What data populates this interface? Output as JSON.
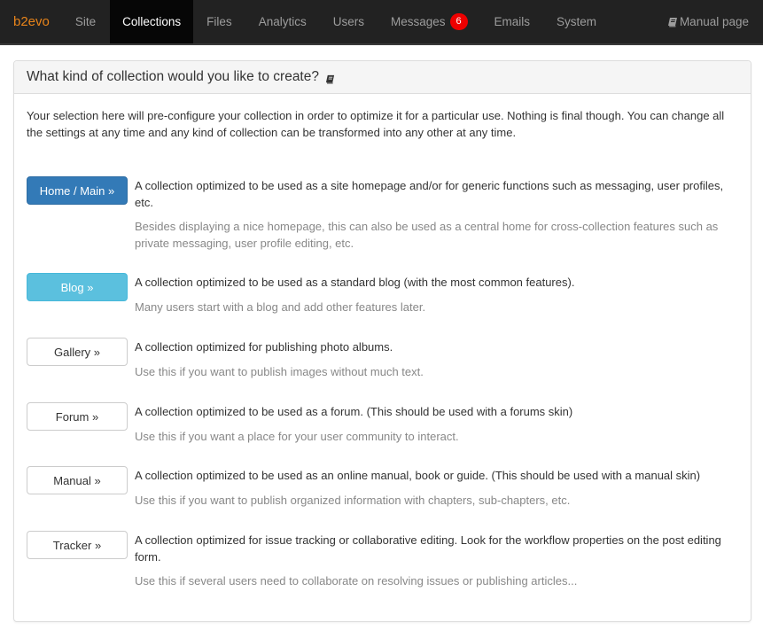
{
  "navbar": {
    "brand": "b2evo",
    "items": [
      {
        "label": "Site",
        "active": false
      },
      {
        "label": "Collections",
        "active": true
      },
      {
        "label": "Files",
        "active": false
      },
      {
        "label": "Analytics",
        "active": false
      },
      {
        "label": "Users",
        "active": false
      },
      {
        "label": "Messages",
        "active": false,
        "badge": "6"
      },
      {
        "label": "Emails",
        "active": false
      },
      {
        "label": "System",
        "active": false
      }
    ],
    "manual_link": {
      "label": "Manual page",
      "icon": "book-icon"
    }
  },
  "colors": {
    "navbar_bg": "#222222",
    "brand": "#e8841a",
    "badge": "#ee0000",
    "primary": "#337ab7",
    "info": "#5bc0de"
  },
  "panel": {
    "title": "What kind of collection would you like to create?",
    "title_icon": "book-icon",
    "intro": "Your selection here will pre-configure your collection in order to optimize it for a particular use. Nothing is final though. You can change all the settings at any time and any kind of collection can be transformed into any other at any time.",
    "options": [
      {
        "button": "Home / Main »",
        "style": "primary",
        "description": "A collection optimized to be used as a site homepage and/or for generic functions such as messaging, user profiles, etc.",
        "note": "Besides displaying a nice homepage, this can also be used as a central home for cross-collection features such as private messaging, user profile editing, etc."
      },
      {
        "button": "Blog »",
        "style": "info",
        "description": "A collection optimized to be used as a standard blog (with the most common features).",
        "note": "Many users start with a blog and add other features later."
      },
      {
        "button": "Gallery »",
        "style": "default",
        "description": "A collection optimized for publishing photo albums.",
        "note": "Use this if you want to publish images without much text."
      },
      {
        "button": "Forum »",
        "style": "default",
        "description": "A collection optimized to be used as a forum. (This should be used with a forums skin)",
        "note": "Use this if you want a place for your user community to interact."
      },
      {
        "button": "Manual »",
        "style": "default",
        "description": "A collection optimized to be used as an online manual, book or guide. (This should be used with a manual skin)",
        "note": "Use this if you want to publish organized information with chapters, sub-chapters, etc."
      },
      {
        "button": "Tracker »",
        "style": "default",
        "description": "A collection optimized for issue tracking or collaborative editing. Look for the workflow properties on the post editing form.",
        "note": "Use this if several users need to collaborate on resolving issues or publishing articles..."
      }
    ]
  }
}
